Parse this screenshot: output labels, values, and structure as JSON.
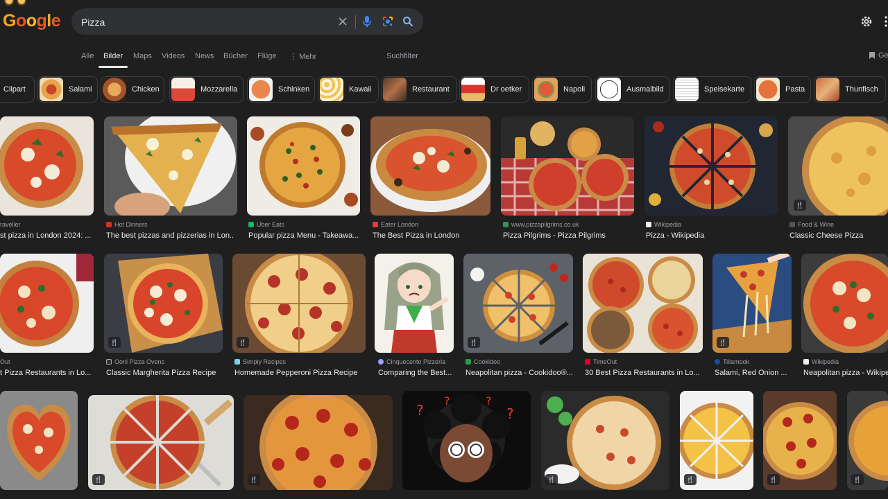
{
  "search": {
    "query": "Pizza"
  },
  "nav": {
    "tabs": [
      "Alle",
      "Bilder",
      "Maps",
      "Videos",
      "News",
      "Bücher",
      "Flüge"
    ],
    "active_tab": "Bilder",
    "more_label": "Mehr",
    "filter_label": "Suchfilter",
    "saved_label": "Ge"
  },
  "chips": [
    "Clipart",
    "Salami",
    "Chicken",
    "Mozzarella",
    "Schinken",
    "Kawaii",
    "Restaurant",
    "Dr oetker",
    "Napoli",
    "Ausmalbild",
    "Speisekarte",
    "Pasta",
    "Thunfisch"
  ],
  "results": {
    "row1": [
      {
        "source": "raveller",
        "title": "st pizza in London 2024: ..."
      },
      {
        "source": "Hot Dinners",
        "title": "The best pizzas and pizzerias in Lon..."
      },
      {
        "source": "Uber Eats",
        "title": "Popular pizza Menu - Takeawa..."
      },
      {
        "source": "Eater London",
        "title": "The Best Pizza in London"
      },
      {
        "source": "www.pizzapilgrims.co.uk",
        "title": "Pizza Pilgrims - Pizza Pilgrims"
      },
      {
        "source": "Wikipedia",
        "title": "Pizza - Wikipedia"
      },
      {
        "source": "Food & Wine",
        "title": "Classic Cheese Pizza"
      }
    ],
    "row2": [
      {
        "source": "Out",
        "title": "t Pizza Restaurants in Lo..."
      },
      {
        "source": "Ooni Pizza Ovens",
        "title": "Classic Margherita Pizza Recipe"
      },
      {
        "source": "Simply Recipes",
        "title": "Homemade Pepperoni Pizza Recipe"
      },
      {
        "source": "Cinquecento Pizzeria",
        "title": "Comparing the Best..."
      },
      {
        "source": "Cookidoo",
        "title": "Neapolitan pizza - Cookidoo®..."
      },
      {
        "source": "TimeOut",
        "title": "30 Best Pizza Restaurants in Lo..."
      },
      {
        "source": "Tillamook",
        "title": "Salami, Red Onion ..."
      },
      {
        "source": "Wikipedia",
        "title": "Neapolitan pizza - Wikiped"
      }
    ]
  },
  "colors": {
    "background": "#1f1f1f",
    "search_bg": "#303134",
    "text_primary": "#e8eaed",
    "text_secondary": "#9aa0a6",
    "accent_blue": "#8ab4f8"
  }
}
